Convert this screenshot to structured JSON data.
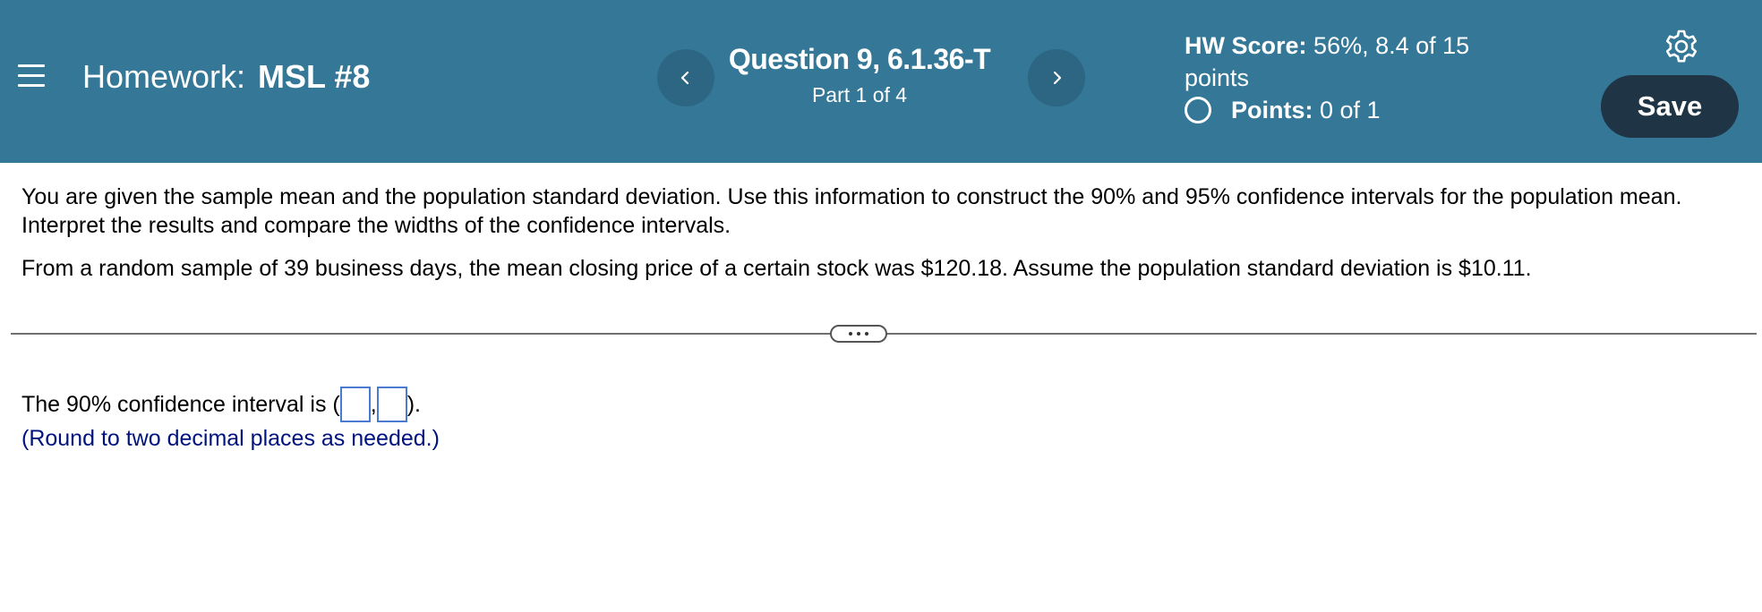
{
  "header": {
    "homework_label": "Homework:",
    "homework_name": "MSL #8",
    "question_title": "Question 9, 6.1.36-T",
    "question_part": "Part 1 of 4",
    "hw_score_label": "HW Score:",
    "hw_score_value": "56%, 8.4 of 15 points",
    "points_label": "Points:",
    "points_value": "0 of 1",
    "save_label": "Save"
  },
  "question": {
    "paragraph1": "You are given the sample mean and the population standard deviation. Use this information to construct the 90% and 95% confidence intervals for the population mean. Interpret the results and compare the widths of the confidence intervals.",
    "paragraph2": "From a random sample of 39 business days, the mean closing price of a certain stock was $120.18. Assume the population standard deviation is $10.11."
  },
  "answer": {
    "prefix": "The 90% confidence interval is (",
    "separator": ",",
    "suffix": ").",
    "lower_value": "",
    "upper_value": "",
    "hint": "(Round to two decimal places as needed.)"
  },
  "icons": {
    "menu": "menu-icon",
    "prev": "chevron-left-icon",
    "next": "chevron-right-icon",
    "settings": "gear-icon",
    "points_status": "circle-icon",
    "more": "ellipsis-icon"
  },
  "colors": {
    "header_bg": "#347797",
    "nav_button_bg": "#2d6683",
    "save_button_bg": "#1f3545",
    "hint_text": "#00127e",
    "input_border": "#4a7bd0"
  }
}
